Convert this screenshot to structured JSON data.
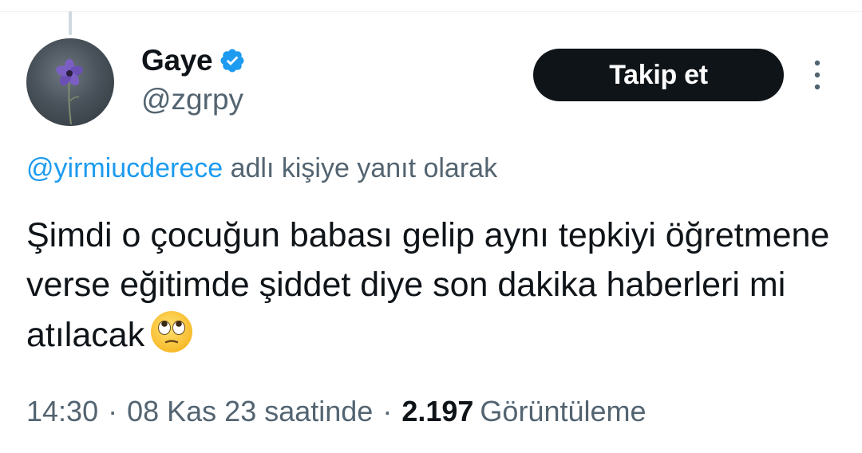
{
  "author": {
    "display_name": "Gaye",
    "handle": "@zgrpy",
    "verified": true,
    "avatar_icon": "flower-avatar"
  },
  "follow_button": {
    "label": "Takip et"
  },
  "more_menu": {
    "icon": "more-vertical-icon"
  },
  "reply_context": {
    "mention": "@yirmiucderece",
    "suffix": " adlı kişiye yanıt olarak"
  },
  "tweet": {
    "text": "Şimdi o çocuğun babası gelip aynı tepkiyi öğretmene verse eğitimde şiddet diye son dakika haberleri mi atılacak",
    "emoji": "face-with-rolling-eyes"
  },
  "meta": {
    "time": "14:30",
    "separator": "·",
    "date": "08 Kas 23 saatinde",
    "views_count": "2.197",
    "views_label": "Görüntüleme"
  },
  "colors": {
    "text_primary": "#0f1419",
    "text_secondary": "#536471",
    "link": "#1d9bf0",
    "verified": "#1d9bf0",
    "follow_bg": "#0f1419"
  }
}
